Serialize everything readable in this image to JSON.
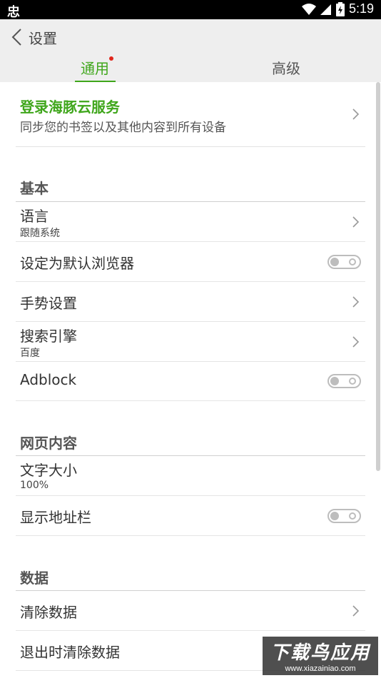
{
  "status_bar": {
    "left_icon": "忠",
    "time": "5:19",
    "icons": [
      "wifi-icon",
      "signal-icon",
      "battery-icon"
    ]
  },
  "header": {
    "title": "设置",
    "back_icon": "chevron-left-icon"
  },
  "tabs": [
    {
      "label": "通用",
      "active": true,
      "has_notification_dot": true
    },
    {
      "label": "高级",
      "active": false
    }
  ],
  "login": {
    "title": "登录海豚云服务",
    "subtitle": "同步您的书签以及其他内容到所有设备"
  },
  "sections": {
    "basic": {
      "title": "基本",
      "items": [
        {
          "label": "语言",
          "sub": "跟随系统",
          "control": "chevron"
        },
        {
          "label": "设定为默认浏览器",
          "control": "toggle",
          "on": false
        },
        {
          "label": "手势设置",
          "control": "chevron"
        },
        {
          "label": "搜索引擎",
          "sub": "百度",
          "control": "chevron"
        },
        {
          "label": "Adblock",
          "control": "toggle",
          "on": false
        }
      ]
    },
    "web": {
      "title": "网页内容",
      "items": [
        {
          "label": "文字大小",
          "sub": "100%"
        },
        {
          "label": "显示地址栏",
          "control": "toggle",
          "on": false
        }
      ]
    },
    "data": {
      "title": "数据",
      "items": [
        {
          "label": "清除数据",
          "control": "chevron"
        },
        {
          "label": "退出时清除数据"
        }
      ]
    }
  },
  "watermark": {
    "line1": "下载鸟应用",
    "line2": "www.xiazainiao.com"
  },
  "colors": {
    "accent": "#3fa61b",
    "dot": "#e0261b",
    "header_bg": "#eeeeee"
  }
}
